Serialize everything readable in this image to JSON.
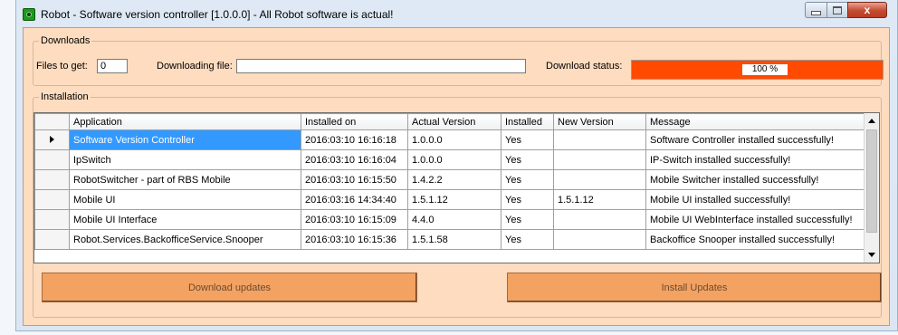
{
  "window": {
    "title": "Robot - Software version controller [1.0.0.0] - All Robot software is actual!",
    "close_glyph": "x"
  },
  "downloads": {
    "legend": "Downloads",
    "files_label": "Files to get:",
    "files_value": "0",
    "downloading_label": "Downloading file:",
    "downloading_value": "",
    "status_label": "Download status:",
    "progress_text": "100 %",
    "progress_fraction": 1.0,
    "progress_color": "#ff4a00"
  },
  "installation": {
    "legend": "Installation",
    "columns": [
      "Application",
      "Installed on",
      "Actual Version",
      "Installed",
      "New Version",
      "Message"
    ],
    "rows": [
      [
        "Software Version Controller",
        "2016:03:10 16:16:18",
        "1.0.0.0",
        "Yes",
        "",
        "Software Controller installed successfully!"
      ],
      [
        "IpSwitch",
        "2016:03:10 16:16:04",
        "1.0.0.0",
        "Yes",
        "",
        "IP-Switch installed successfully!"
      ],
      [
        "RobotSwitcher - part of RBS Mobile",
        "2016:03:10 16:15:50",
        "1.4.2.2",
        "Yes",
        "",
        "Mobile Switcher installed successfully!"
      ],
      [
        "Mobile UI",
        "2016:03:16 14:34:40",
        "1.5.1.12",
        "Yes",
        "1.5.1.12",
        "Mobile UI installed successfully!"
      ],
      [
        "Mobile UI Interface",
        "2016:03:10 16:15:09",
        "4.4.0",
        "Yes",
        "",
        "Mobile UI WebInterface installed successfully!"
      ],
      [
        "Robot.Services.BackofficeService.Snooper",
        "2016:03:10 16:15:36",
        "1.5.1.58",
        "Yes",
        "",
        "Backoffice Snooper installed successfully!"
      ]
    ],
    "selected_row": 0
  },
  "buttons": {
    "download_updates": "Download updates",
    "install_updates": "Install Updates"
  },
  "colors": {
    "client_background": "#fddcbf",
    "button_background": "#f3a262",
    "selection": "#3399ff"
  }
}
